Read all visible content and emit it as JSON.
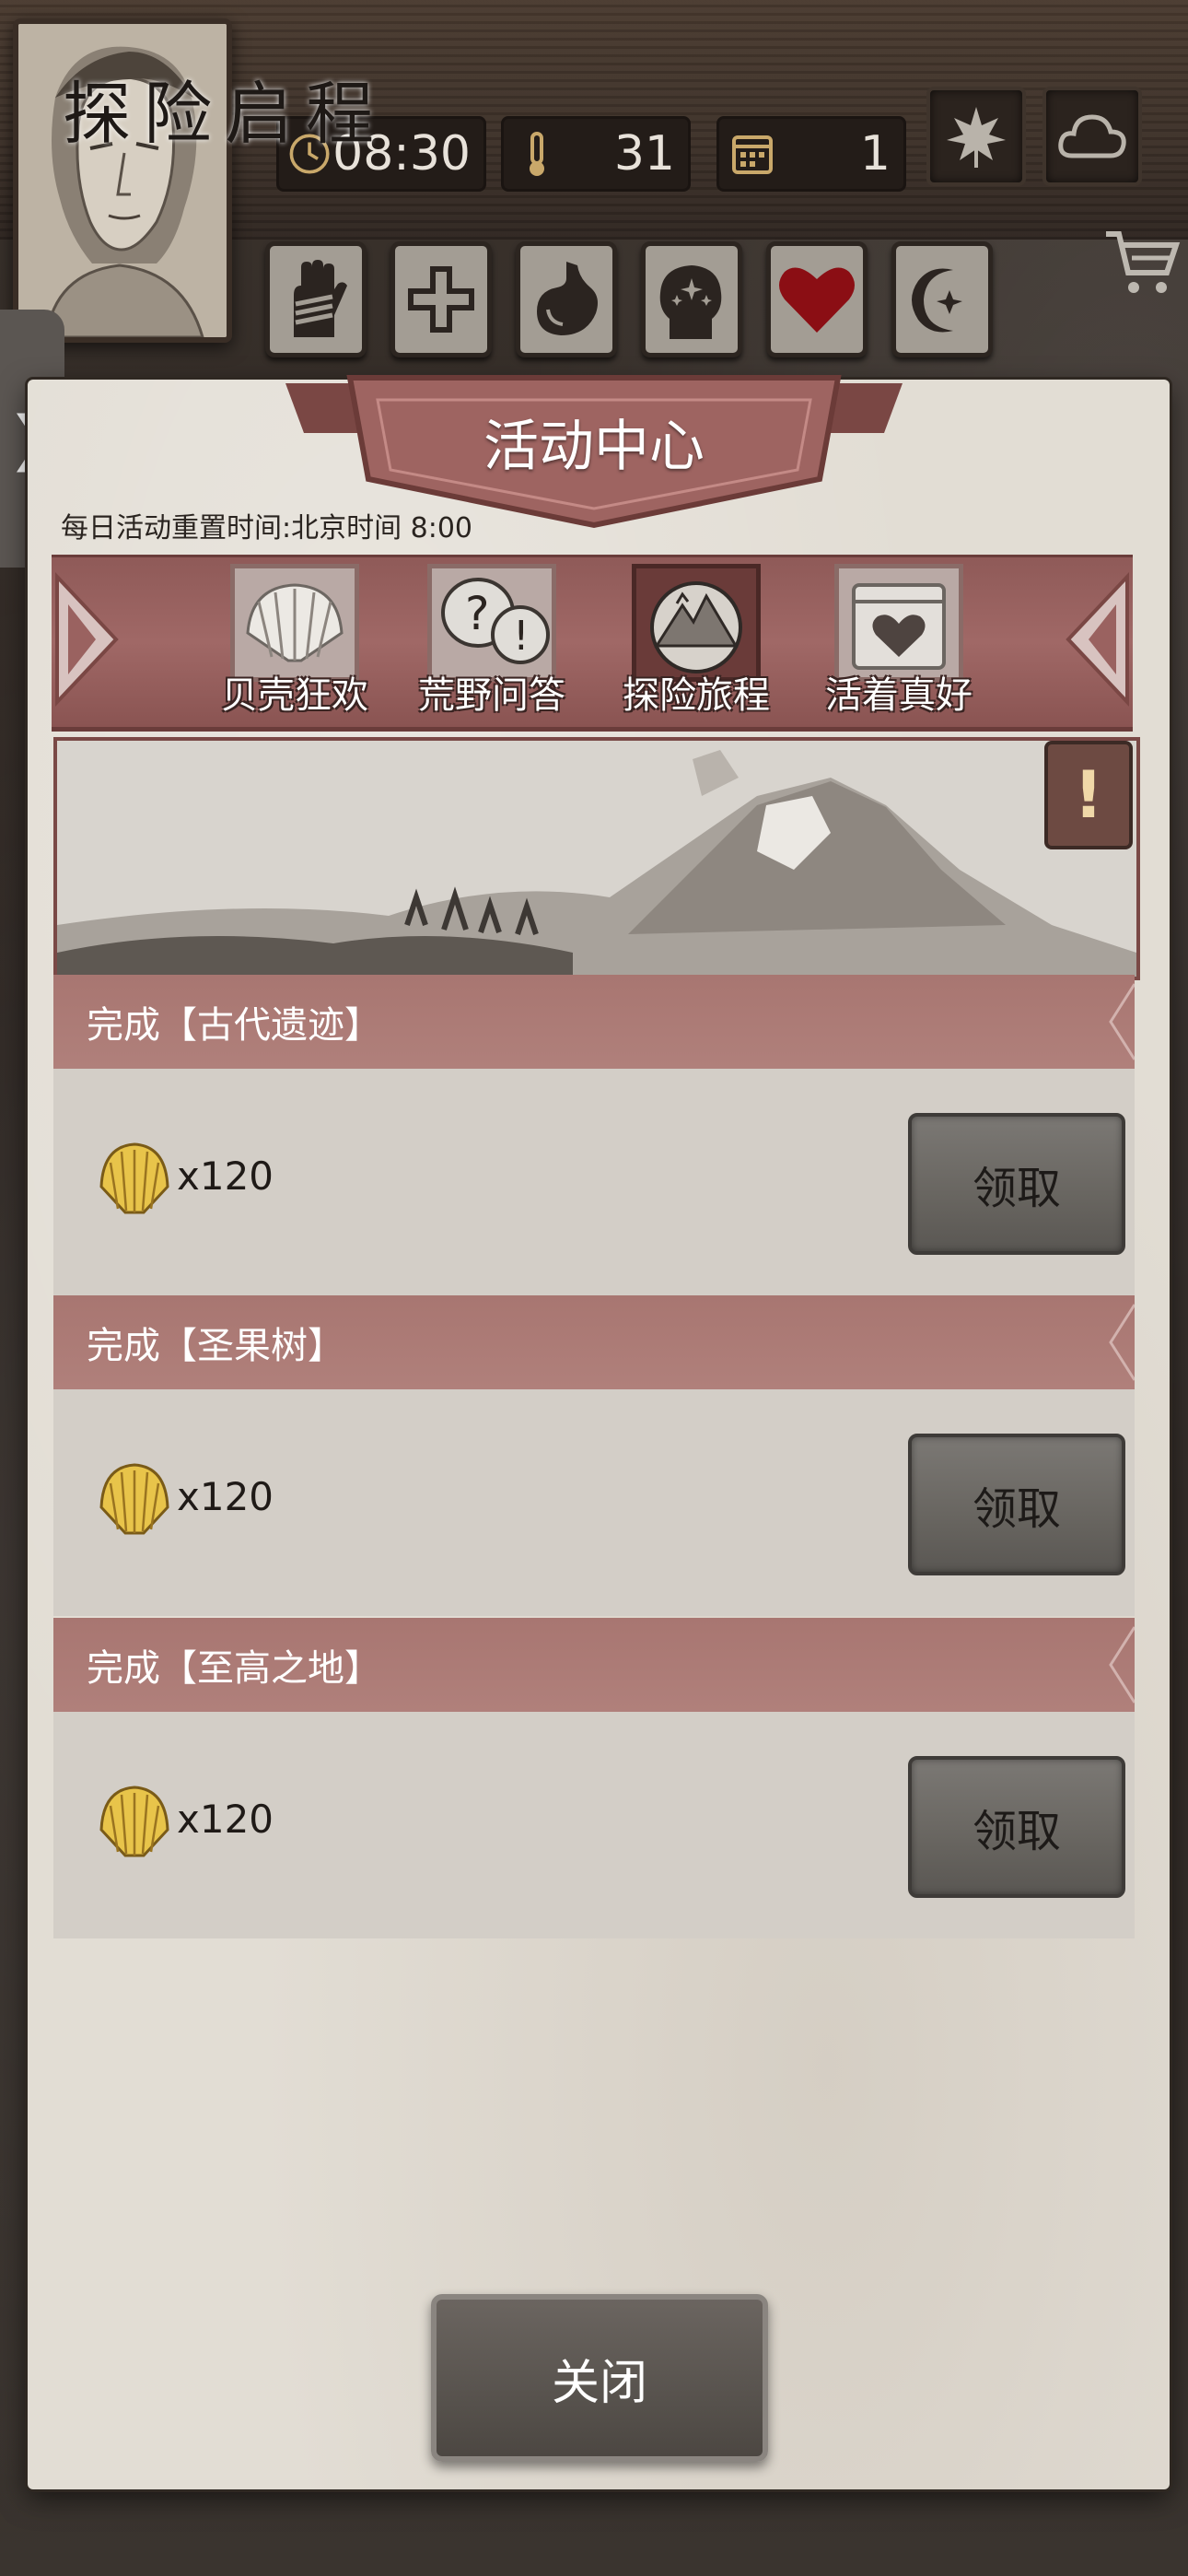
{
  "hud": {
    "time": "08:30",
    "temperature": "31",
    "day": "1",
    "icons": [
      "clock-icon",
      "thermometer-icon",
      "calendar-icon",
      "leaf-icon",
      "cloud-icon",
      "cart-icon"
    ],
    "status_icons": [
      "hand-bandage-icon",
      "health-cross-icon",
      "stomach-icon",
      "head-sparkle-icon",
      "heart-icon",
      "moon-star-icon"
    ],
    "heart_color": "#8b0e14"
  },
  "panel": {
    "title": "活动中心",
    "reset_note": "每日活动重置时间:北京时间 8:00",
    "tabs": [
      {
        "label": "贝壳狂欢",
        "icon": "shell-icon",
        "active": false
      },
      {
        "label": "荒野问答",
        "icon": "question-bubbles-icon",
        "active": false
      },
      {
        "label": "探险旅程",
        "icon": "mountain-globe-icon",
        "active": true
      },
      {
        "label": "活着真好",
        "icon": "calendar-heart-icon",
        "active": false
      }
    ],
    "hero_title": "探险启程",
    "info_symbol": "!",
    "quests": [
      {
        "title": "完成【古代遗迹】",
        "reward": "x120",
        "button": "领取"
      },
      {
        "title": "完成【圣果树】",
        "reward": "x120",
        "button": "领取"
      },
      {
        "title": "完成【至高之地】",
        "reward": "x120",
        "button": "领取"
      }
    ],
    "close_label": "关闭"
  },
  "colors": {
    "tab_strip": "#9a6260",
    "quest_header": "#ad7b76",
    "parchment": "#e2ddd4"
  }
}
